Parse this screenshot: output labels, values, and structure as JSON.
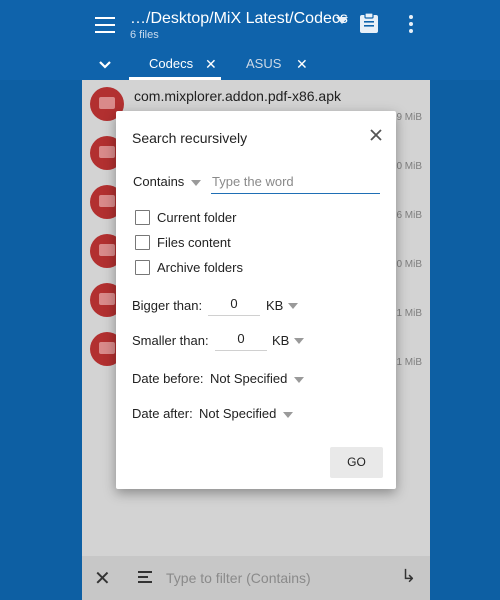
{
  "app_bar": {
    "path": "…/Desktop/MiX Latest/Codecs",
    "subtitle": "6 files"
  },
  "tabs": [
    {
      "label": "Codecs",
      "active": true
    },
    {
      "label": "ASUS",
      "active": false
    }
  ],
  "file_list": [
    {
      "name": "com.mixplorer.addon.pdf-x86.apk",
      "size": "9 MiB"
    },
    {
      "name": "",
      "size": "0 MiB"
    },
    {
      "name": "",
      "size": "6 MiB"
    },
    {
      "name": "",
      "size": "0 MiB"
    },
    {
      "name": "",
      "size": "1 MiB"
    },
    {
      "name": "",
      "size": "1 MiB"
    }
  ],
  "bottom_bar": {
    "filter_placeholder": "Type to filter (Contains)"
  },
  "dialog": {
    "title": "Search recursively",
    "match_mode": "Contains",
    "search_placeholder": "Type the word",
    "options": [
      {
        "label": "Current folder",
        "checked": false
      },
      {
        "label": "Files content",
        "checked": false
      },
      {
        "label": "Archive folders",
        "checked": false
      }
    ],
    "bigger_than": {
      "label": "Bigger than:",
      "value": "0",
      "unit": "KB"
    },
    "smaller_than": {
      "label": "Smaller than:",
      "value": "0",
      "unit": "KB"
    },
    "date_before": {
      "label": "Date before:",
      "value": "Not Specified"
    },
    "date_after": {
      "label": "Date after:",
      "value": "Not Specified"
    },
    "go_label": "GO"
  },
  "colors": {
    "app_bar": "#0f63ab",
    "accent": "#1f6fb5",
    "file_icon": "#b23030"
  }
}
